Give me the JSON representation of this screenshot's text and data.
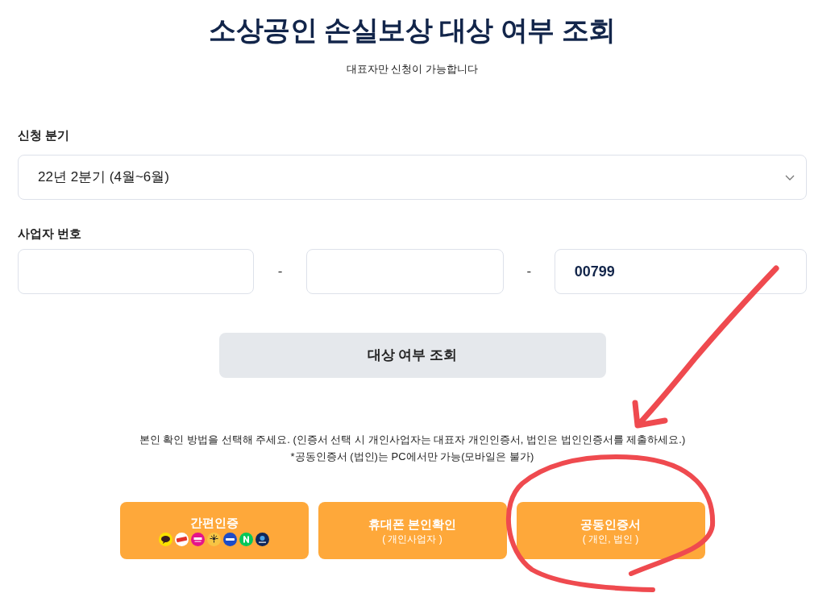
{
  "page": {
    "title": "소상공인 손실보상 대상 여부 조회",
    "subtitle": "대표자만 신청이 가능합니다"
  },
  "quarter": {
    "label": "신청 분기",
    "value": "22년 2분기 (4월~6월)"
  },
  "business_number": {
    "label": "사업자 번호",
    "fields": [
      {
        "kind": "blank"
      },
      {
        "kind": "blank"
      },
      {
        "kind": "text",
        "value": "00799"
      }
    ],
    "separators": [
      "-",
      "-"
    ]
  },
  "search_button": "대상 여부 조회",
  "notice": [
    "본인 확인 방법을 선택해 주세요. (인증서 선택 시 개인사업자는 대표자 개인인증서, 법인은 법인인증서를 제출하세요.)",
    "*공동인증서 (법인)는 PC에서만 가능(모바일은 불가)"
  ],
  "auth_methods": [
    {
      "kind": "logos",
      "label": "간편인증"
    },
    {
      "kind": "note",
      "label": "휴대폰 본인확인",
      "note": "( 개인사업자 )"
    },
    {
      "kind": "note",
      "label": "공동인증서",
      "note": "( 개인, 법인 )"
    }
  ],
  "hand_drawn_markup": {
    "arrow": true,
    "circle": true
  }
}
